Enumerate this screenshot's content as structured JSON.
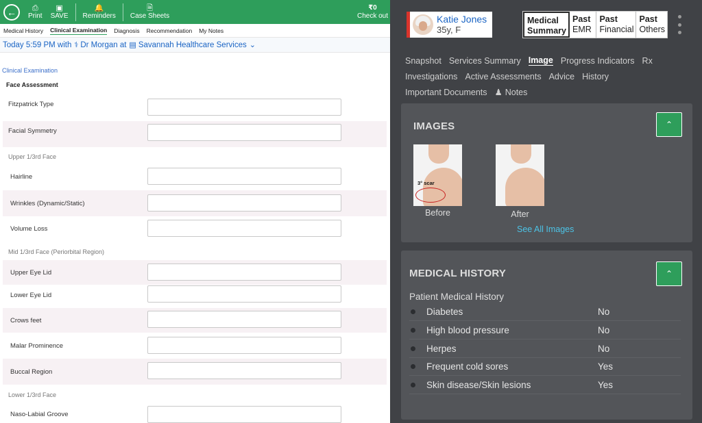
{
  "toolbar": {
    "back_label": "",
    "print": "Print",
    "save": "SAVE",
    "reminders": "Reminders",
    "case_sheets": "Case Sheets",
    "checkout_amount": "₹0",
    "checkout_label": "Check out"
  },
  "subtabs": [
    "Medical History",
    "Clinical Examination",
    "Diagnosis",
    "Recommendation",
    "My Notes"
  ],
  "visit": {
    "time": "Today 5:59 PM with",
    "doctor": "Dr Morgan at",
    "clinic": "Savannah Healthcare Services"
  },
  "form": {
    "section_title": "Clinical Examination",
    "face_assessment": "Face Assessment",
    "fields": {
      "fitzpatrick": "Fitzpatrick Type",
      "symmetry": "Facial Symmetry",
      "upper_group": "Upper 1/3rd Face",
      "hairline": "Hairline",
      "wrinkles": "Wrinkles (Dynamic/Static)",
      "volume": "Volume Loss",
      "mid_group": "Mid 1/3rd Face (Periorbital Region)",
      "upper_lid": "Upper Eye Lid",
      "lower_lid": "Lower Eye Lid",
      "crows": "Crows feet",
      "malar": "Malar Prominence",
      "buccal": "Buccal Region",
      "lower_group": "Lower 1/3rd Face",
      "naso": "Naso-Labial Groove"
    }
  },
  "patient": {
    "name": "Katie Jones",
    "age_sex": "35y, F"
  },
  "top_tabs": [
    {
      "line1": "Medical",
      "line2": "Summary"
    },
    {
      "line1": "Past",
      "line2": "EMR"
    },
    {
      "line1": "Past",
      "line2": "Financial"
    },
    {
      "line1": "Past",
      "line2": "Others"
    }
  ],
  "nav": {
    "snapshot": "Snapshot",
    "services": "Services Summary",
    "image": "Image",
    "progress": "Progress Indicators",
    "rx": "Rx",
    "investigations": "Investigations",
    "assessments": "Active Assessments",
    "advice": "Advice",
    "history": "History",
    "documents": "Important Documents",
    "notes": "Notes"
  },
  "images": {
    "title": "IMAGES",
    "before": "Before",
    "after": "After",
    "scar_annotation": "3° scar",
    "see_all": "See All Images"
  },
  "medical_history": {
    "title": "MEDICAL HISTORY",
    "subtitle": "Patient Medical History",
    "items": [
      {
        "condition": "Diabetes",
        "value": "No"
      },
      {
        "condition": "High blood pressure",
        "value": "No"
      },
      {
        "condition": "Herpes",
        "value": "No"
      },
      {
        "condition": "Frequent cold sores",
        "value": "Yes"
      },
      {
        "condition": "Skin disease/Skin lesions",
        "value": "Yes"
      }
    ]
  },
  "colors": {
    "brand_green": "#2e9e5b",
    "link_blue": "#1a64c4",
    "dark_panel": "#404246",
    "card": "#535559",
    "accent_cyan": "#4cc3e6",
    "alert_red": "#d9342b"
  },
  "icons": [
    "back-arrow-icon",
    "printer-icon",
    "floppy-disk-icon",
    "bell-icon",
    "document-icon",
    "doctor-icon",
    "hospital-icon",
    "chevron-down-icon",
    "notes-person-icon",
    "chevron-up-icon",
    "kebab-menu-icon"
  ]
}
